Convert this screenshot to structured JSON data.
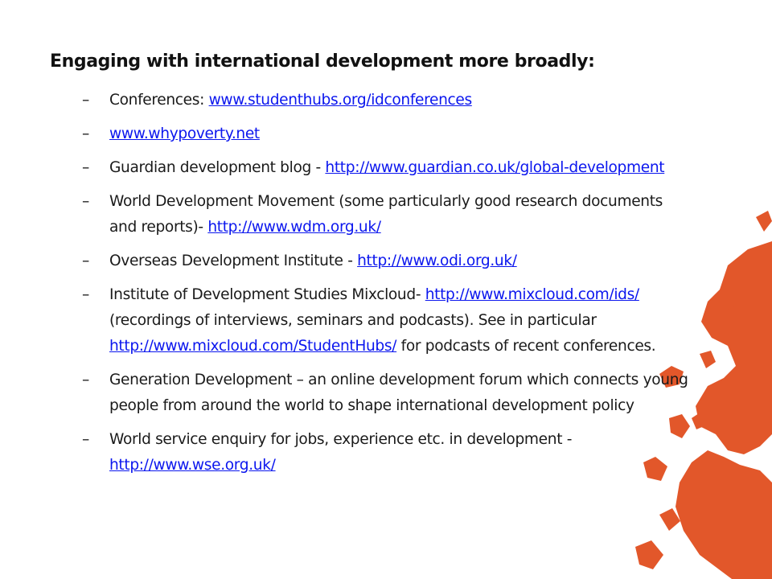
{
  "colors": {
    "link": "#0b16ee",
    "accent_globe": "#e2572a",
    "text": "#1a1a1a"
  },
  "heading": "Engaging with international development more broadly:",
  "bullet": "–",
  "items": [
    {
      "before": "Conferences: ",
      "link": "www.studenthubs.org/idconferences",
      "after": ""
    },
    {
      "before": "",
      "link": "www.whypoverty.net",
      "after": ""
    },
    {
      "before": "Guardian development blog - ",
      "link": "http://www.guardian.co.uk/global-development",
      "after": ""
    },
    {
      "before": "World Development Movement (some particularly good research documents and reports)- ",
      "link": "http://www.wdm.org.uk/",
      "after": ""
    },
    {
      "before": "Overseas Development Institute - ",
      "link": "http://www.odi.org.uk/",
      "after": ""
    },
    {
      "before": "Institute of Development Studies Mixcloud- ",
      "link": "http://www.mixcloud.com/ids/",
      "after": " (recordings of interviews, seminars and podcasts). See in particular ",
      "link2": "http://www.mixcloud.com/StudentHubs/",
      "after2": " for podcasts of recent conferences."
    },
    {
      "before": "Generation Development – an online development forum which connects young people from around the world to shape international development policy",
      "link": "",
      "after": ""
    },
    {
      "before": "World service enquiry for jobs, experience etc. in development - ",
      "link": "http://www.wse.org.uk/",
      "after": ""
    }
  ]
}
